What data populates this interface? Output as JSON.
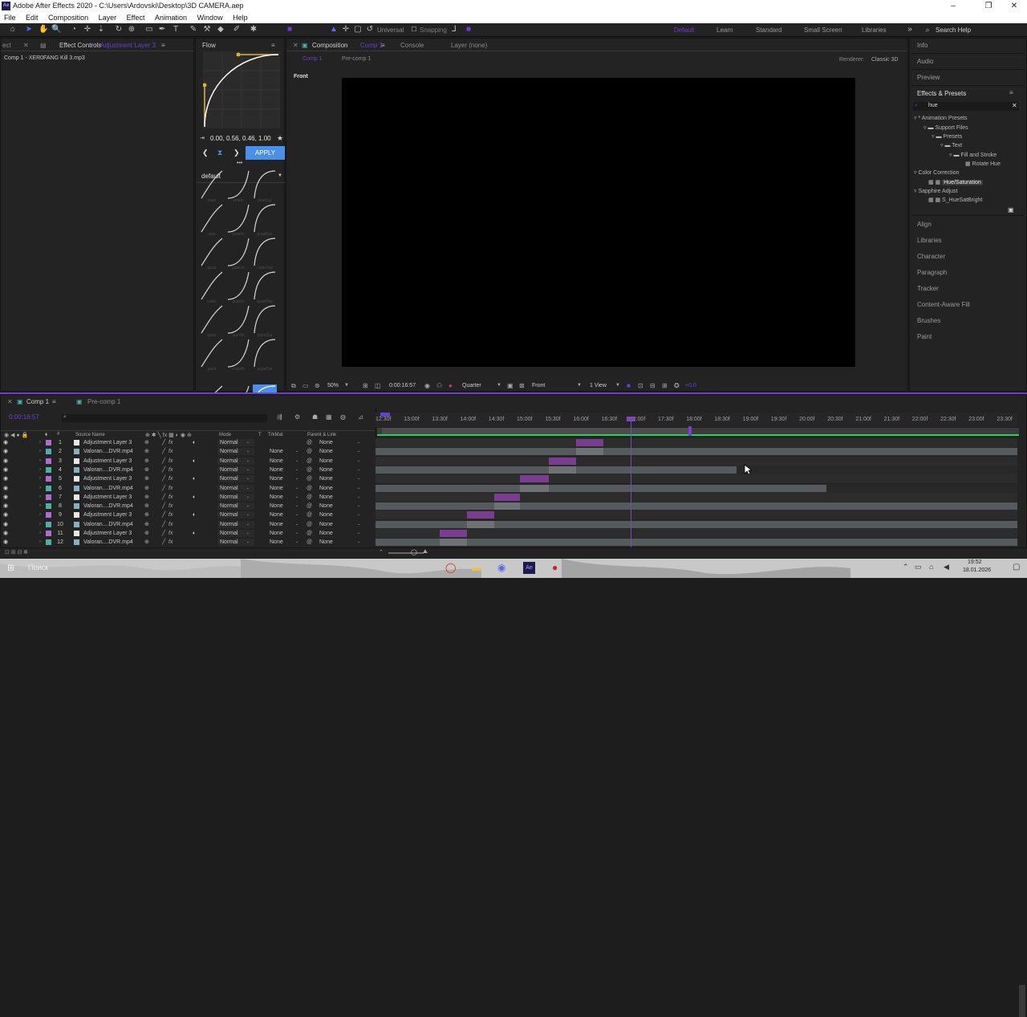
{
  "window": {
    "title": "Adobe After Effects 2020 - C:\\Users\\Ardovski\\Desktop\\3D CAMERA.aep",
    "logo": "Ae",
    "minimize": "–",
    "maximize": "❐",
    "close": "✕"
  },
  "menu": [
    "File",
    "Edit",
    "Composition",
    "Layer",
    "Effect",
    "Animation",
    "Window",
    "Help"
  ],
  "toolbar": {
    "universal": "Universal",
    "snapping": "Snapping",
    "workspaces": [
      "Default",
      "Learn",
      "Standard",
      "Small Screen",
      "Libraries"
    ],
    "search_help": "Search Help"
  },
  "left_panel": {
    "tab_prefix": "ect",
    "tab": "Effect Controls",
    "tab_suffix": "Adjustment Layer 3",
    "item": "Comp 1 - XER0FANG Kill 3.mp3"
  },
  "flow": {
    "title": "Flow",
    "values": "0.00, 0.56, 0.46, 1.00",
    "apply": "APPLY",
    "preset": "default",
    "more": "•••",
    "labels": [
      "ease",
      "sineIn",
      "sineOut",
      "sine",
      "quadIn",
      "quadOut",
      "quad",
      "cubicIn",
      "cubicOut",
      "cubic",
      "quartIn",
      "quartOut",
      "quart",
      "quintIn",
      "quintOut",
      "quint",
      "expoIn",
      "expoOut"
    ]
  },
  "composition": {
    "tab": "Composition",
    "tab_name": "Comp 1",
    "console": "Console",
    "layer": "Layer (none)",
    "subtab_active": "Comp 1",
    "subtab": "Pre-comp 1",
    "renderer_label": "Renderer:",
    "renderer": "Classic 3D",
    "view_label": "Front",
    "footer": {
      "zoom": "50%",
      "time": "0:00:16:57",
      "quality": "Quarter",
      "view": "Front",
      "views": "1 View",
      "exposure": "+0.0"
    }
  },
  "right_panel": {
    "info": "Info",
    "audio": "Audio",
    "preview": "Preview",
    "effects_presets": "Effects & Presets",
    "search": "hue",
    "tree": [
      "* Animation Presets",
      "Support Files",
      "Presets",
      "Text",
      "Fill and Stroke",
      "Rotate Hue",
      "Color Correction",
      "Hue/Saturation",
      "Sapphire Adjust",
      "S_HueSatBright"
    ],
    "items": [
      "Align",
      "Libraries",
      "Character",
      "Paragraph",
      "Tracker",
      "Content-Aware Fill",
      "Brushes",
      "Paint"
    ]
  },
  "timeline": {
    "tab1": "Comp 1",
    "tab2": "Pre-comp 1",
    "timecode": "0:00:16:57",
    "headers": {
      "source": "Source Name",
      "mode": "Mode",
      "t": "T",
      "trkmat": "TrkMat",
      "parent": "Parent & Link"
    },
    "ticks": [
      "12:30f",
      "13:00f",
      "13:30f",
      "14:00f",
      "14:30f",
      "15:00f",
      "15:30f",
      "16:00f",
      "16:30f",
      "17:00f",
      "17:30f",
      "18:00f",
      "18:30f",
      "19:00f",
      "19:30f",
      "20:00f",
      "20:30f",
      "21:00f",
      "21:30f",
      "22:00f",
      "22:30f",
      "23:00f",
      "23:30f"
    ],
    "layers": [
      {
        "num": "1",
        "name": "Adjustment Layer 3",
        "mode": "Normal",
        "trkmat": "",
        "parent": "None"
      },
      {
        "num": "2",
        "name": "Valoran....DVR.mp4",
        "mode": "Normal",
        "trkmat": "None",
        "parent": "None"
      },
      {
        "num": "3",
        "name": "Adjustment Layer 3",
        "mode": "Normal",
        "trkmat": "None",
        "parent": "None"
      },
      {
        "num": "4",
        "name": "Valoran....DVR.mp4",
        "mode": "Normal",
        "trkmat": "None",
        "parent": "None"
      },
      {
        "num": "5",
        "name": "Adjustment Layer 3",
        "mode": "Normal",
        "trkmat": "None",
        "parent": "None"
      },
      {
        "num": "6",
        "name": "Valoran....DVR.mp4",
        "mode": "Normal",
        "trkmat": "None",
        "parent": "None"
      },
      {
        "num": "7",
        "name": "Adjustment Layer 3",
        "mode": "Normal",
        "trkmat": "None",
        "parent": "None"
      },
      {
        "num": "8",
        "name": "Valoran....DVR.mp4",
        "mode": "Normal",
        "trkmat": "None",
        "parent": "None"
      },
      {
        "num": "9",
        "name": "Adjustment Layer 3",
        "mode": "Normal",
        "trkmat": "None",
        "parent": "None"
      },
      {
        "num": "10",
        "name": "Valoran....DVR.mp4",
        "mode": "Normal",
        "trkmat": "None",
        "parent": "None"
      },
      {
        "num": "11",
        "name": "Adjustment Layer 3",
        "mode": "Normal",
        "trkmat": "None",
        "parent": "None"
      },
      {
        "num": "12",
        "name": "Valoran....DVR.mp4",
        "mode": "Normal",
        "trkmat": "None",
        "parent": "None"
      }
    ]
  },
  "taskbar": {
    "search": "Поиск",
    "time": "19:52",
    "date": "18.01.2026"
  },
  "colors": {
    "accent": "#6a3fd0",
    "purple_bar": "#7a3d8f",
    "gray_bar": "#5c6264",
    "blue": "#4a8fe8"
  }
}
